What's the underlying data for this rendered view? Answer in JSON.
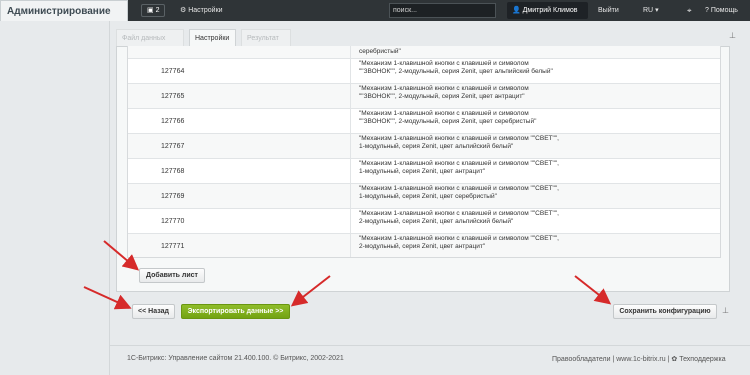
{
  "topbar": {
    "brand": "Администрирование",
    "count": "2",
    "settings": "Настройки",
    "search": "поиск...",
    "user": "Дмитрий Климов",
    "exit": "Выйти",
    "lang": "RU",
    "help": "Помощь"
  },
  "tabs": [
    "Файл данных",
    "Настройки",
    "Результат"
  ],
  "rows": [
    {
      "id": "",
      "name": "серебристый\""
    },
    {
      "id": "127764",
      "name": "\"Механизм 1-клавишной кнопки с клавишей и символом \"\"ЗВОНОК\"\", 2-модульный, серия Zenit, цвет альпийский белый\""
    },
    {
      "id": "127765",
      "name": "\"Механизм 1-клавишной кнопки с клавишей и символом \"\"ЗВОНОК\"\", 2-модульный, серия Zenit, цвет антрацит\""
    },
    {
      "id": "127766",
      "name": "\"Механизм 1-клавишной кнопки с клавишей и символом \"\"ЗВОНОК\"\", 2-модульный, серия Zenit, цвет серебристый\""
    },
    {
      "id": "127767",
      "name": "\"Механизм 1-клавишной кнопки с клавишей и символом \"\"СВЕТ\"\", 1-модульный, серия Zenit, цвет альпийский белый\""
    },
    {
      "id": "127768",
      "name": "\"Механизм 1-клавишной кнопки с клавишей и символом \"\"СВЕТ\"\", 1-модульный, серия Zenit, цвет антрацит\""
    },
    {
      "id": "127769",
      "name": "\"Механизм 1-клавишной кнопки с клавишей и символом \"\"СВЕТ\"\", 1-модульный, серия Zenit, цвет серебристый\""
    },
    {
      "id": "127770",
      "name": "\"Механизм 1-клавишной кнопки с клавишей и символом \"\"СВЕТ\"\", 2-модульный, серия Zenit, цвет альпийский белый\""
    },
    {
      "id": "127771",
      "name": "\"Механизм 1-клавишной кнопки с клавишей и символом \"\"СВЕТ\"\", 2-модульный, серия Zenit, цвет антрацит\""
    }
  ],
  "buttons": {
    "add_sheet": "Добавить лист",
    "back": "<< Назад",
    "export": "Экспортировать данные >>",
    "save_config": "Сохранить конфигурацию"
  },
  "footer": {
    "left": "1С-Битрикс: Управление сайтом 21.400.100. © Битрикс, 2002-2021",
    "rightholders": "Правообладатели",
    "site": "www.1c-bitrix.ru",
    "support": "Техподдержка"
  },
  "colors": {
    "topbar": "#2f3437",
    "accent_green": "#7fb11b",
    "arrow": "#d62a2a"
  }
}
